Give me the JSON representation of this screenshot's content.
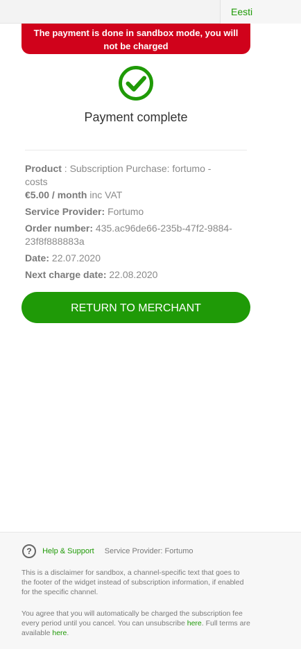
{
  "header": {
    "language": "Eesti"
  },
  "sandbox_notice": "The payment is done in sandbox mode, you will not be charged",
  "status": {
    "icon": "check-circle-icon",
    "title": "Payment complete",
    "accent": "#1f9a07"
  },
  "details": {
    "product_label": "Product",
    "product_text": "Subscription Purchase: fortumo - costs",
    "price": "€5.00 / month",
    "vat": "inc VAT",
    "provider_label": "Service Provider:",
    "provider_value": "Fortumo",
    "order_label": "Order number:",
    "order_value": "435.ac96de66-235b-47f2-9884-23f8f888883a",
    "date_label": "Date:",
    "date_value": "22.07.2020",
    "next_charge_label": "Next charge date:",
    "next_charge_value": "22.08.2020"
  },
  "action": {
    "return_label": "RETURN TO MERCHANT"
  },
  "footer": {
    "help_label": "Help & Support",
    "provider_text": "Service Provider: Fortumo",
    "disclaimer": "This is a disclaimer for sandbox, a channel-specific text that goes to the footer of the widget instead of subscription information, if enabled for the specific channel.",
    "agree_prefix": "You agree that you will automatically be charged the subscription fee every period until you cancel. You can unsubscribe",
    "unsubscribe_link": "here",
    "agree_middle": ". Full terms are available",
    "terms_link": "here",
    "agree_suffix": "."
  }
}
